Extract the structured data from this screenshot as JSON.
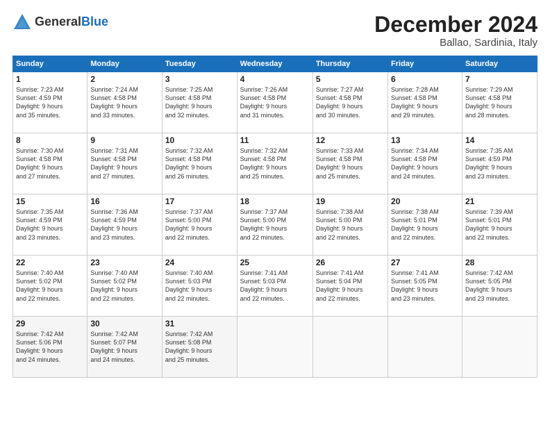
{
  "logo": {
    "general": "General",
    "blue": "Blue"
  },
  "title": "December 2024",
  "location": "Ballao, Sardinia, Italy",
  "days_of_week": [
    "Sunday",
    "Monday",
    "Tuesday",
    "Wednesday",
    "Thursday",
    "Friday",
    "Saturday"
  ],
  "weeks": [
    [
      {
        "day": "1",
        "info": "Sunrise: 7:23 AM\nSunset: 4:59 PM\nDaylight: 9 hours\nand 35 minutes."
      },
      {
        "day": "2",
        "info": "Sunrise: 7:24 AM\nSunset: 4:58 PM\nDaylight: 9 hours\nand 33 minutes."
      },
      {
        "day": "3",
        "info": "Sunrise: 7:25 AM\nSunset: 4:58 PM\nDaylight: 9 hours\nand 32 minutes."
      },
      {
        "day": "4",
        "info": "Sunrise: 7:26 AM\nSunset: 4:58 PM\nDaylight: 9 hours\nand 31 minutes."
      },
      {
        "day": "5",
        "info": "Sunrise: 7:27 AM\nSunset: 4:58 PM\nDaylight: 9 hours\nand 30 minutes."
      },
      {
        "day": "6",
        "info": "Sunrise: 7:28 AM\nSunset: 4:58 PM\nDaylight: 9 hours\nand 29 minutes."
      },
      {
        "day": "7",
        "info": "Sunrise: 7:29 AM\nSunset: 4:58 PM\nDaylight: 9 hours\nand 28 minutes."
      }
    ],
    [
      {
        "day": "8",
        "info": "Sunrise: 7:30 AM\nSunset: 4:58 PM\nDaylight: 9 hours\nand 27 minutes."
      },
      {
        "day": "9",
        "info": "Sunrise: 7:31 AM\nSunset: 4:58 PM\nDaylight: 9 hours\nand 27 minutes."
      },
      {
        "day": "10",
        "info": "Sunrise: 7:32 AM\nSunset: 4:58 PM\nDaylight: 9 hours\nand 26 minutes."
      },
      {
        "day": "11",
        "info": "Sunrise: 7:32 AM\nSunset: 4:58 PM\nDaylight: 9 hours\nand 25 minutes."
      },
      {
        "day": "12",
        "info": "Sunrise: 7:33 AM\nSunset: 4:58 PM\nDaylight: 9 hours\nand 25 minutes."
      },
      {
        "day": "13",
        "info": "Sunrise: 7:34 AM\nSunset: 4:58 PM\nDaylight: 9 hours\nand 24 minutes."
      },
      {
        "day": "14",
        "info": "Sunrise: 7:35 AM\nSunset: 4:59 PM\nDaylight: 9 hours\nand 23 minutes."
      }
    ],
    [
      {
        "day": "15",
        "info": "Sunrise: 7:35 AM\nSunset: 4:59 PM\nDaylight: 9 hours\nand 23 minutes."
      },
      {
        "day": "16",
        "info": "Sunrise: 7:36 AM\nSunset: 4:59 PM\nDaylight: 9 hours\nand 23 minutes."
      },
      {
        "day": "17",
        "info": "Sunrise: 7:37 AM\nSunset: 5:00 PM\nDaylight: 9 hours\nand 22 minutes."
      },
      {
        "day": "18",
        "info": "Sunrise: 7:37 AM\nSunset: 5:00 PM\nDaylight: 9 hours\nand 22 minutes."
      },
      {
        "day": "19",
        "info": "Sunrise: 7:38 AM\nSunset: 5:00 PM\nDaylight: 9 hours\nand 22 minutes."
      },
      {
        "day": "20",
        "info": "Sunrise: 7:38 AM\nSunset: 5:01 PM\nDaylight: 9 hours\nand 22 minutes."
      },
      {
        "day": "21",
        "info": "Sunrise: 7:39 AM\nSunset: 5:01 PM\nDaylight: 9 hours\nand 22 minutes."
      }
    ],
    [
      {
        "day": "22",
        "info": "Sunrise: 7:40 AM\nSunset: 5:02 PM\nDaylight: 9 hours\nand 22 minutes."
      },
      {
        "day": "23",
        "info": "Sunrise: 7:40 AM\nSunset: 5:02 PM\nDaylight: 9 hours\nand 22 minutes."
      },
      {
        "day": "24",
        "info": "Sunrise: 7:40 AM\nSunset: 5:03 PM\nDaylight: 9 hours\nand 22 minutes."
      },
      {
        "day": "25",
        "info": "Sunrise: 7:41 AM\nSunset: 5:03 PM\nDaylight: 9 hours\nand 22 minutes."
      },
      {
        "day": "26",
        "info": "Sunrise: 7:41 AM\nSunset: 5:04 PM\nDaylight: 9 hours\nand 22 minutes."
      },
      {
        "day": "27",
        "info": "Sunrise: 7:41 AM\nSunset: 5:05 PM\nDaylight: 9 hours\nand 23 minutes."
      },
      {
        "day": "28",
        "info": "Sunrise: 7:42 AM\nSunset: 5:05 PM\nDaylight: 9 hours\nand 23 minutes."
      }
    ],
    [
      {
        "day": "29",
        "info": "Sunrise: 7:42 AM\nSunset: 5:06 PM\nDaylight: 9 hours\nand 24 minutes."
      },
      {
        "day": "30",
        "info": "Sunrise: 7:42 AM\nSunset: 5:07 PM\nDaylight: 9 hours\nand 24 minutes."
      },
      {
        "day": "31",
        "info": "Sunrise: 7:42 AM\nSunset: 5:08 PM\nDaylight: 9 hours\nand 25 minutes."
      },
      null,
      null,
      null,
      null
    ]
  ]
}
